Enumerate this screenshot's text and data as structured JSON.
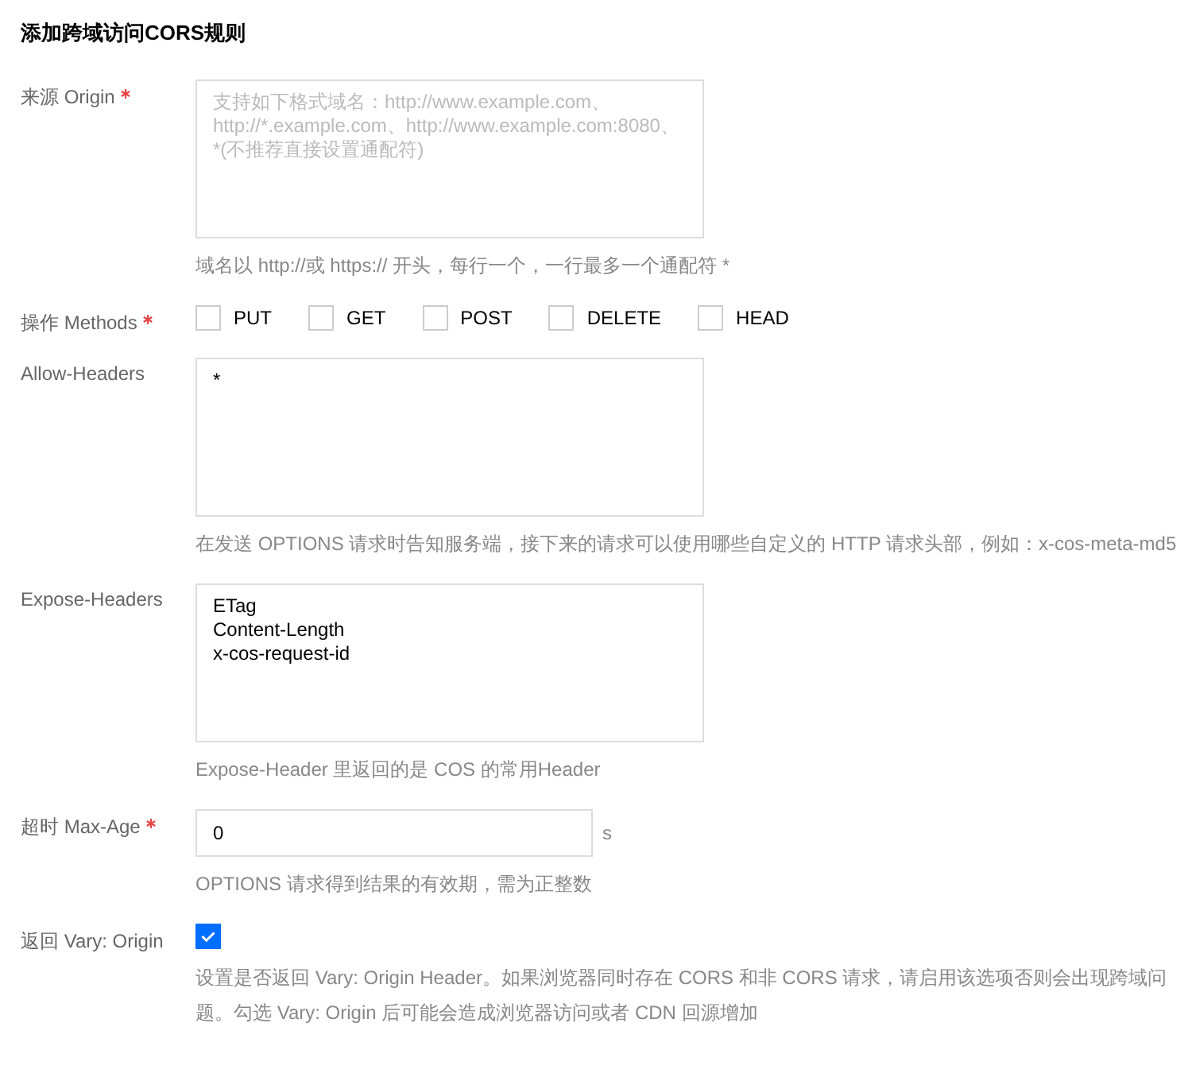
{
  "title": "添加跨域访问CORS规则",
  "fields": [
    {
      "kind": "textarea",
      "label": "来源 Origin",
      "required": true,
      "placeholder": "支持如下格式域名：http://www.example.com、http://*.example.com、http://www.example.com:8080、*(不推荐直接设置通配符)",
      "help": "域名以 http://或 https:// 开头，每行一个，一行最多一个通配符 *"
    },
    {
      "kind": "checkboxes",
      "label": "操作 Methods",
      "required": true,
      "options": [
        {
          "label": "PUT",
          "checked": false
        },
        {
          "label": "GET",
          "checked": false
        },
        {
          "label": "POST",
          "checked": false
        },
        {
          "label": "DELETE",
          "checked": false
        },
        {
          "label": "HEAD",
          "checked": false
        }
      ]
    },
    {
      "kind": "textarea",
      "label": "Allow-Headers",
      "required": false,
      "value": "*",
      "help": "在发送 OPTIONS 请求时告知服务端，接下来的请求可以使用哪些自定义的 HTTP 请求头部，例如：x-cos-meta-md5"
    },
    {
      "kind": "textarea",
      "label": "Expose-Headers",
      "required": false,
      "value": "ETag\nContent-Length\nx-cos-request-id",
      "help": "Expose-Header 里返回的是 COS 的常用Header"
    },
    {
      "kind": "number",
      "label": "超时 Max-Age",
      "required": true,
      "value": "0",
      "unit": "s",
      "help": "OPTIONS 请求得到结果的有效期，需为正整数"
    },
    {
      "kind": "checkbox",
      "label": "返回 Vary: Origin",
      "required": false,
      "checked": true,
      "help": "设置是否返回 Vary: Origin Header。如果浏览器同时存在 CORS 和非 CORS 请求，请启用该选项否则会出现跨域问题。勾选 Vary: Origin 后可能会造成浏览器访问或者 CDN 回源增加"
    }
  ]
}
